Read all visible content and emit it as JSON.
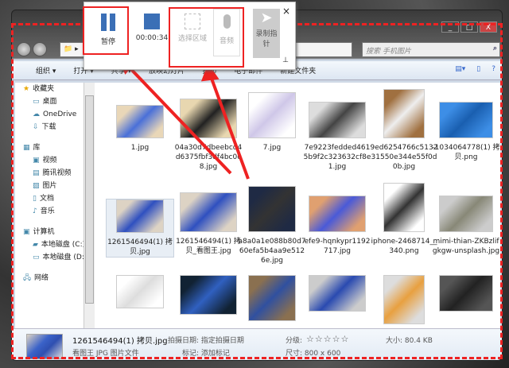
{
  "window": {
    "search_placeholder": "搜索 手机图片",
    "caption_buttons": [
      "_",
      "□",
      "X"
    ]
  },
  "toolbar": {
    "items": [
      "组织 ▾",
      "打开 ▾",
      "共享 ▾",
      "放映幻灯片",
      "打印",
      "电子邮件",
      "新建文件夹"
    ]
  },
  "sidebar": {
    "favorites": "收藏夹",
    "items": [
      {
        "icon": "▭",
        "label": "桌面"
      },
      {
        "icon": "☁",
        "label": "OneDrive"
      },
      {
        "icon": "⇩",
        "label": "下载"
      }
    ],
    "library": "库",
    "lib_items": [
      {
        "icon": "▣",
        "label": "视频"
      },
      {
        "icon": "▤",
        "label": "腾讯视频"
      },
      {
        "icon": "▨",
        "label": "图片"
      },
      {
        "icon": "▯",
        "label": "文档"
      },
      {
        "icon": "♪",
        "label": "音乐"
      }
    ],
    "computer": "计算机",
    "drives": [
      {
        "icon": "▰",
        "label": "本地磁盘 (C:)"
      },
      {
        "icon": "▭",
        "label": "本地磁盘 (D:)"
      }
    ],
    "network": "网络"
  },
  "files": [
    {
      "name": "1.jpg",
      "c1": "#e9d7b8",
      "c2": "#4a70d8"
    },
    {
      "name": "04a30d7dbeebcd4d6375fbf3df4bc0c8.jpg",
      "c1": "#e8d7b0",
      "c2": "#222"
    },
    {
      "name": "7.jpg",
      "c1": "#fff",
      "c2": "#cfc7e8"
    },
    {
      "name": "7e9223fedded4615b9f2c323632cf8e1.jpg",
      "c1": "#ddd",
      "c2": "#444"
    },
    {
      "name": "9ed6254766c513231550e344e55f0d0b.jpg",
      "c1": "#a07040",
      "c2": "#eee"
    },
    {
      "name": "-1034064778(1) 拷贝.png",
      "c1": "#3d8ee6",
      "c2": "#1a5fb0"
    },
    {
      "name": "1261546494(1) 拷贝.jpg",
      "c1": "#ddd3c4",
      "c2": "#2f50c0"
    },
    {
      "name": "1261546494(1) 拷贝_看图王.jpg",
      "c1": "#ddd3c4",
      "c2": "#2f50c0"
    },
    {
      "name": "a8a0a1e088b80d760efa5b4aa9e5126e.jpg",
      "c1": "#1f2a44",
      "c2": "#333"
    },
    {
      "name": "efe9-hqnkypr1192717.jpg",
      "c1": "#e0a070",
      "c2": "#4a5ad8"
    },
    {
      "name": "iphone-2468714__340.png",
      "c1": "#fff",
      "c2": "#333"
    },
    {
      "name": "mimi-thian-ZKBzlifgkgw-unsplash.jpg",
      "c1": "#ccc",
      "c2": "#887"
    },
    {
      "name": "",
      "c1": "#fff",
      "c2": "#ddd"
    },
    {
      "name": "",
      "c1": "#123",
      "c2": "#3060c0"
    },
    {
      "name": "",
      "c1": "#8a7050",
      "c2": "#3050a0"
    },
    {
      "name": "",
      "c1": "#ccc",
      "c2": "#2a4ab0"
    },
    {
      "name": "",
      "c1": "#ddd",
      "c2": "#e8a040"
    },
    {
      "name": "",
      "c1": "#555",
      "c2": "#222"
    }
  ],
  "details": {
    "filename": "1261546494(1) 拷贝.jpg",
    "type": "看图王 JPG 图片文件",
    "date_label": "拍摄日期: 指定拍摄日期",
    "tag_label": "标记: 添加标记",
    "rating_label": "分级:",
    "stars": "☆☆☆☆☆",
    "size_label": "大小: 80.4 KB",
    "dims_label": "尺寸: 800 x 600"
  },
  "recorder": {
    "pause": "暂停",
    "time": "00:00:34",
    "select_area": "选择区域",
    "audio": "音频",
    "record_pointer": "录制指针",
    "close": "×",
    "pin": "⊥"
  },
  "colors": {
    "annotation": "#e22",
    "accent": "#3b6fb6"
  }
}
